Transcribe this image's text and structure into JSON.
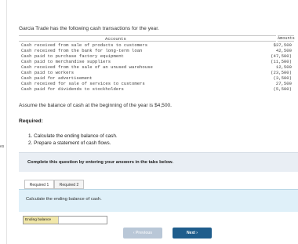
{
  "side_label": "es",
  "intro": "Garcia Trade has the following cash transactions for the year.",
  "transactions": {
    "col_desc": "Accounts",
    "col_amt": "Amounts",
    "rows": [
      {
        "desc": "Cash received from sale of products to customers",
        "amt": "$37,500"
      },
      {
        "desc": "Cash received from the bank for long-term loan",
        "amt": "42,500"
      },
      {
        "desc": "Cash paid to purchase factory equipment",
        "amt": "(47,500)"
      },
      {
        "desc": "Cash paid to merchandise suppliers",
        "amt": "(11,500)"
      },
      {
        "desc": "Cash received from the sale of an unused warehouse",
        "amt": "12,500"
      },
      {
        "desc": "Cash paid to workers",
        "amt": "(23,500)"
      },
      {
        "desc": "Cash paid for advertisement",
        "amt": "(3,500)"
      },
      {
        "desc": "Cash received for sale of services to customers",
        "amt": "27,500"
      },
      {
        "desc": "Cash paid for dividends to stockholders",
        "amt": "(5,500)"
      }
    ]
  },
  "assume": "Assume the balance of cash at the beginning of the year is $4,500.",
  "required": {
    "heading": "Required:",
    "items": [
      "1. Calculate the ending balance of cash.",
      "2. Prepare a statement of cash flows."
    ]
  },
  "instruction": "Complete this question by entering your answers in the tabs below.",
  "tabs": [
    "Required 1",
    "Required 2"
  ],
  "task": "Calculate the ending balance of cash.",
  "answer": {
    "label": "Ending balance",
    "value": ""
  },
  "nav": {
    "prev": "Previous",
    "next": "Next"
  }
}
